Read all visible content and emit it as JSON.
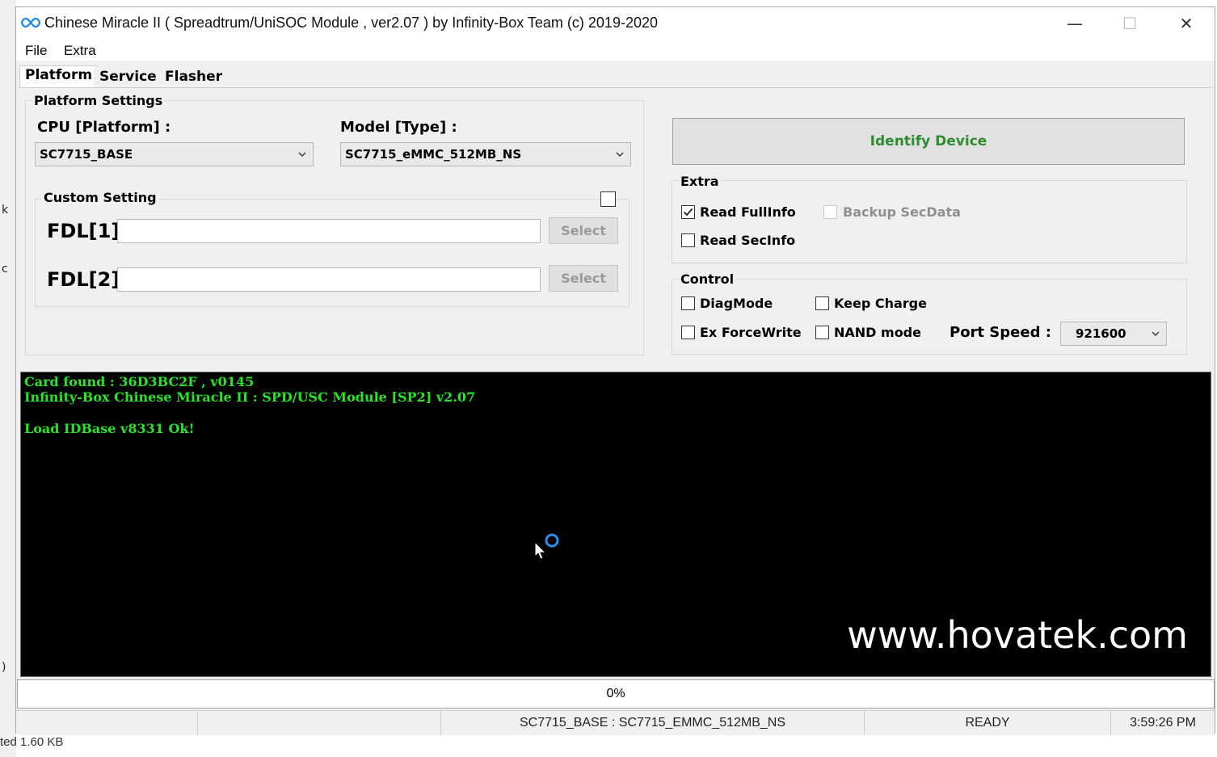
{
  "background": {
    "fragments": [
      "k",
      "c",
      ")"
    ],
    "statusbar_text": "ted  1.60 KB"
  },
  "window": {
    "title": "Chinese Miracle II ( Spreadtrum/UniSOC Module , ver2.07  ) by Infinity-Box Team (c) 2019-2020",
    "controls": {
      "minimize": "—",
      "maximize": "☐",
      "close": "✕"
    }
  },
  "menu": {
    "items": [
      "File",
      "Extra"
    ]
  },
  "tabs": [
    {
      "label": "Platform",
      "active": true
    },
    {
      "label": "Service",
      "active": false
    },
    {
      "label": "Flasher",
      "active": false
    }
  ],
  "platform_settings": {
    "title": "Platform Settings",
    "cpu_label": "CPU [Platform] :",
    "cpu_value": "SC7715_BASE",
    "model_label": "Model [Type] :",
    "model_value": "SC7715_eMMC_512MB_NS",
    "custom_setting": {
      "title": "Custom Setting",
      "enabled": false,
      "fdl1_label": "FDL[1]",
      "fdl1_value": "",
      "fdl2_label": "FDL[2]",
      "fdl2_value": "",
      "select_label": "Select"
    }
  },
  "identify_button": "Identify Device",
  "extra": {
    "title": "Extra",
    "read_fullinfo": {
      "label": "Read FullInfo",
      "checked": true
    },
    "backup_secdata": {
      "label": "Backup SecData",
      "checked": false,
      "disabled": true
    },
    "read_secinfo": {
      "label": "Read SecInfo",
      "checked": false
    }
  },
  "control": {
    "title": "Control",
    "diagmode": {
      "label": "DiagMode",
      "checked": false
    },
    "keep_charge": {
      "label": "Keep Charge",
      "checked": false
    },
    "ex_forcewrite": {
      "label": "Ex ForceWrite",
      "checked": false
    },
    "nand_mode": {
      "label": "NAND mode",
      "checked": false
    },
    "port_speed_label": "Port Speed :",
    "port_speed_value": "921600"
  },
  "console": {
    "lines": [
      "Card found : 36D3BC2F , v0145",
      "Infinity-Box Chinese Miracle II : SPD/USC Module [SP2] v2.07",
      "",
      "Load IDBase v8331 Ok!"
    ],
    "text_color": "#26e626",
    "watermark": "www.hovatek.com"
  },
  "progress": {
    "percent": 0,
    "label": "0%"
  },
  "statusbar": {
    "cells": [
      "",
      "",
      "SC7715_BASE : SC7715_EMMC_512MB_NS",
      "READY",
      "3:59:26 PM"
    ]
  },
  "colors": {
    "identify_text": "#2e8b2e",
    "console_bg": "#000000",
    "progress_fill": "#06b025"
  }
}
